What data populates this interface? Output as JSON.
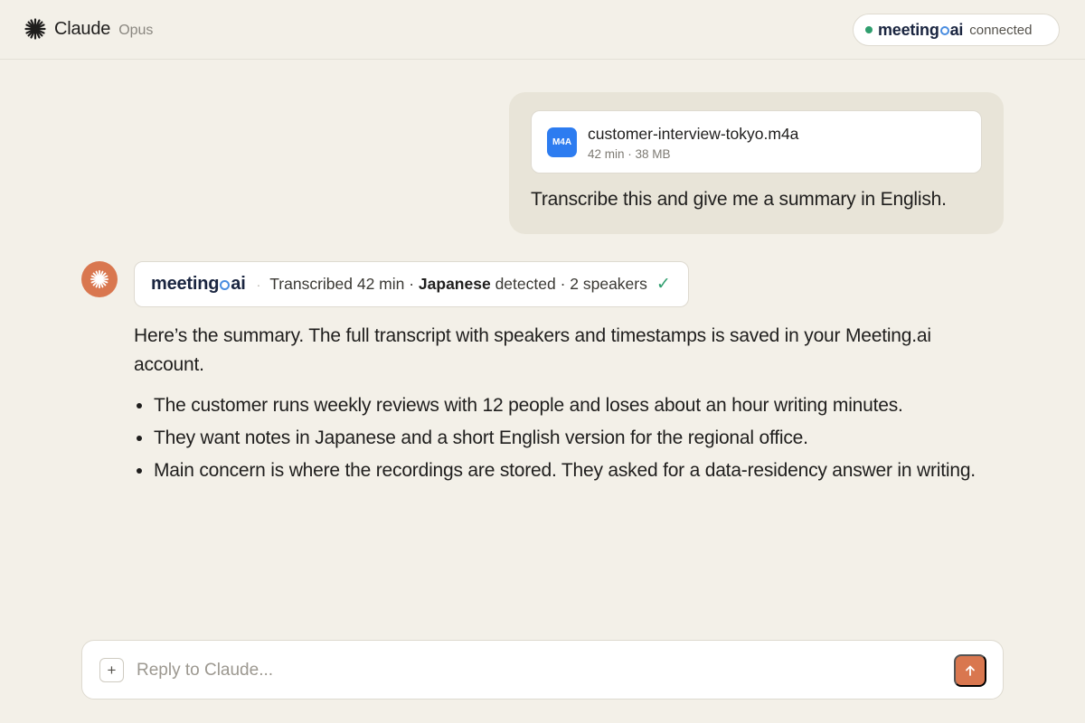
{
  "header": {
    "app_name": "Claude",
    "model": "Opus",
    "brand_icon": "claude-asterisk-icon",
    "connection": {
      "logo_left": "meeting",
      "logo_right": "ai",
      "status": "connected",
      "status_color": "#2f9e6e"
    }
  },
  "user_message": {
    "attachment": {
      "badge": "M4A",
      "file_name": "customer-interview-tokyo.m4a",
      "meta": "42 min · 38 MB"
    },
    "text": "Transcribe this and give me a summary in English."
  },
  "assistant_message": {
    "tool_result": {
      "logo_left": "meeting",
      "logo_right": "ai",
      "prefix": "Transcribed 42 min · ",
      "language": "Japanese",
      "suffix": " detected · 2 speakers",
      "check": "✓"
    },
    "intro": "Here’s the summary. The full transcript with speakers and timestamps is saved in your Meeting.ai account.",
    "bullets": [
      "The customer runs weekly reviews with 12 people and loses about an hour writing minutes.",
      "They want notes in Japanese and a short English version for the regional office.",
      "Main concern is where the recordings are stored. They asked for a data-residency answer in writing."
    ]
  },
  "composer": {
    "placeholder": "Reply to Claude...",
    "add_label": "+"
  },
  "colors": {
    "accent": "#d9774f",
    "file_badge": "#2d7cf0",
    "background": "#f3f0e8"
  }
}
